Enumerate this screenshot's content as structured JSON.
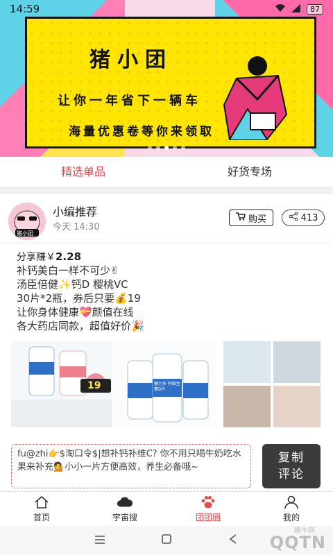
{
  "status_bar": {
    "time": "14:59",
    "battery": "87"
  },
  "banner": {
    "title": "猪小团",
    "line1": "让你一年省下一辆车",
    "line2": "海量优惠卷等你来领取"
  },
  "tabs": [
    {
      "label": "精选单品",
      "active": true
    },
    {
      "label": "好货专场",
      "active": false
    }
  ],
  "post": {
    "avatar_text": "猪小团",
    "author": "小编推荐",
    "time": "今天 14:30",
    "buy_label": "购买",
    "share_count": "413",
    "earn_prefix": "分享赚￥",
    "earn_amount": "2.28",
    "text_lines": [
      "补钙美白一样不可少✌",
      "汤臣倍健✨钙D 樱桃VC",
      "30片*2瓶，券后只要💰19",
      "让你身体健康💝颜值在线",
      "各大药店同款，超值好价🎉"
    ],
    "product_label": "健力多 钙维生素D片",
    "price_tag": "19",
    "copy_text": "fu@zhi👉$淘口令$|想补钙补维C? 你不用只喝牛奶吃水果来补充💁小小一片方便高效，养生必备哦~",
    "copy_button": [
      "复制",
      "评论"
    ]
  },
  "bottom_nav": [
    {
      "label": "首页",
      "icon": "home-icon",
      "active": false
    },
    {
      "label": "宇宙搜",
      "icon": "cloud-icon",
      "active": false
    },
    {
      "label": "团团圈",
      "icon": "paw-icon",
      "active": true
    },
    {
      "label": "我的",
      "icon": "person-icon",
      "active": false
    }
  ],
  "watermark": {
    "brand": "QQTN",
    "sub": "腾牛网"
  },
  "colors": {
    "accent": "#e8474e",
    "banner_yellow": "#ffe600",
    "copy_button": "#3b3b3b"
  }
}
